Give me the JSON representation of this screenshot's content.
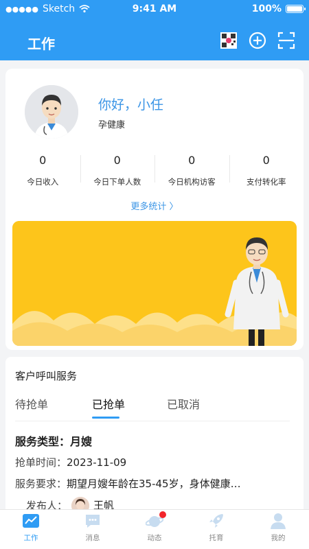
{
  "status_bar": {
    "carrier": "Sketch",
    "time": "9:41 AM",
    "battery": "100%",
    "battery_level": 1.0
  },
  "nav": {
    "title": "工作",
    "icons": [
      "qr-code-icon",
      "plus-circle-icon",
      "scan-icon"
    ]
  },
  "profile": {
    "greeting": "你好，小任",
    "company": "孕健康"
  },
  "stats": [
    {
      "value": "0",
      "label": "今日收入"
    },
    {
      "value": "0",
      "label": "今日下单人数"
    },
    {
      "value": "0",
      "label": "今日机构访客"
    },
    {
      "value": "0",
      "label": "支付转化率"
    }
  ],
  "more_stats": "更多统计 〉",
  "service": {
    "title": "客户呼叫服务",
    "tabs": [
      "待抢单",
      "已抢单",
      "已取消"
    ],
    "active_tab": "已抢单",
    "type_label": "服务类型：",
    "type_value": "月嫂",
    "time_label": "抢单时间：",
    "time_value": "2023-11-09",
    "req_label": "服务要求：",
    "req_value": "期望月嫂年龄在35-45岁，身体健康…",
    "publisher_label": "发布人：",
    "publisher_name": "王帆"
  },
  "tabbar": [
    {
      "label": "工作",
      "icon": "chart-icon",
      "active": true
    },
    {
      "label": "消息",
      "icon": "message-icon",
      "active": false
    },
    {
      "label": "动态",
      "icon": "planet-icon",
      "active": false,
      "badge": true
    },
    {
      "label": "托育",
      "icon": "rocket-icon",
      "active": false
    },
    {
      "label": "我的",
      "icon": "user-icon",
      "active": false
    }
  ],
  "colors": {
    "primary": "#2f9cf4",
    "banner": "#fdc51b",
    "badge": "#f2252b"
  }
}
